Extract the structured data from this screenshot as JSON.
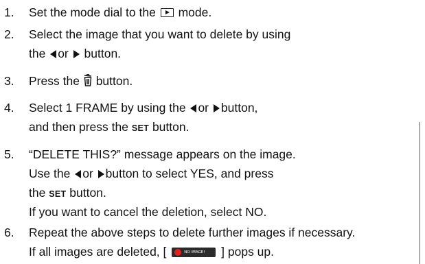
{
  "steps": [
    {
      "num": "1.",
      "lines": [
        {
          "a": "Set the mode dial to the",
          "b": "mode."
        }
      ]
    },
    {
      "num": "2.",
      "lines": [
        {
          "a": "Select the image that you want to delete by using"
        },
        {
          "a": "the",
          "b": "or",
          "c": "button."
        }
      ]
    },
    {
      "num": "3.",
      "lines": [
        {
          "a": "Press the",
          "b": "button."
        }
      ]
    },
    {
      "num": "4.",
      "lines": [
        {
          "a": "Select 1 FRAME by using the",
          "b": "or",
          "c": "button,"
        },
        {
          "a": "and then press the",
          "set": "SET",
          "b": "button."
        }
      ]
    },
    {
      "num": "5.",
      "lines": [
        {
          "a": "“DELETE THIS?” message appears on the image."
        },
        {
          "a": "Use the",
          "b": "or",
          "c": "button to select YES, and press"
        },
        {
          "a": "the",
          "set": "SET",
          "b": "button."
        },
        {
          "a": "If you want to cancel the deletion, select NO."
        }
      ]
    },
    {
      "num": "6.",
      "lines": [
        {
          "a": "Repeat the above steps to delete further images if necessary."
        },
        {
          "a": "If all images are deleted, [",
          "badge": "NO IMAGE!",
          "b": "] pops up."
        }
      ]
    }
  ],
  "icons": {
    "playback": "playback-mode-icon",
    "left": "left-arrow-icon",
    "right": "right-arrow-icon",
    "trash": "trash-icon",
    "badge_dot_color": "#e0221f"
  }
}
